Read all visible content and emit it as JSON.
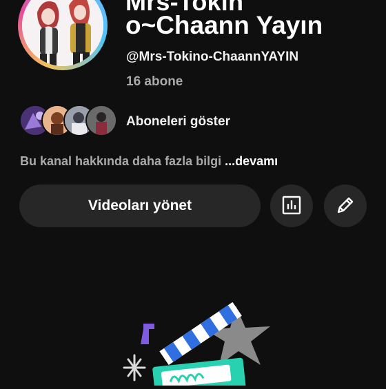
{
  "channel": {
    "name_line1": "Mrs-Tokin",
    "name_line2": "o~Chaann Yayın",
    "handle": "@Mrs-Tokino-ChaannYAYIN",
    "subscriber_count": "16 abone"
  },
  "subscribers": {
    "show_label": "Aboneleri göster"
  },
  "about": {
    "text": "Bu kanal hakkında daha fazla bilgi",
    "more": " ...devamı"
  },
  "actions": {
    "manage_videos": "Videoları yönet",
    "analytics_icon": "analytics-icon",
    "edit_icon": "pencil-icon"
  },
  "colors": {
    "background": "#0f0f0f",
    "button": "#272727",
    "muted_text": "#aaaaaa"
  }
}
